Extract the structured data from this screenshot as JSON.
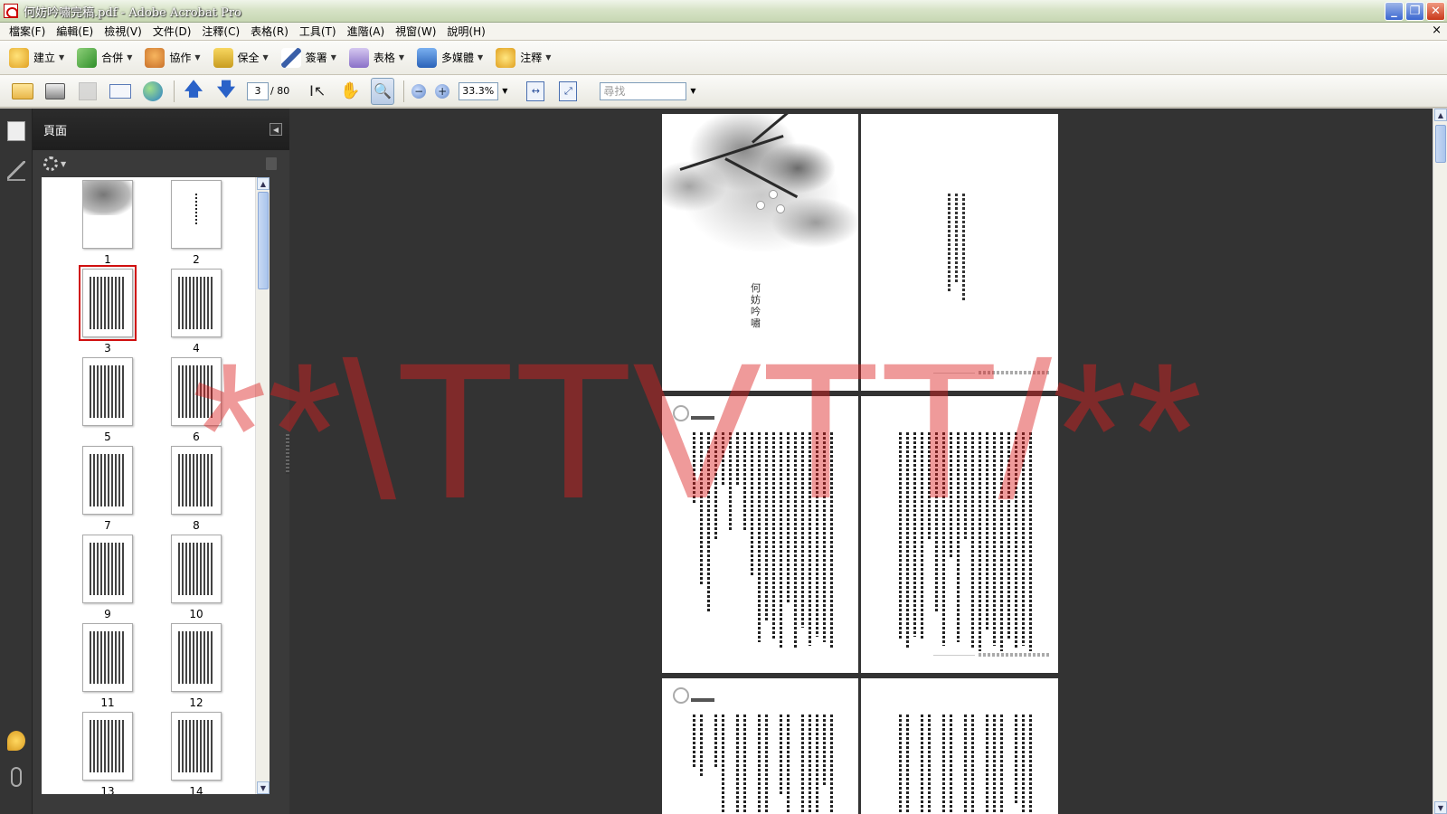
{
  "window": {
    "title": "何妨吟嘯完稿.pdf - Adobe Acrobat Pro",
    "controls": {
      "minimize": "_",
      "restore": "❐",
      "close": "✕"
    }
  },
  "menu": {
    "items": [
      "檔案(F)",
      "編輯(E)",
      "檢視(V)",
      "文件(D)",
      "注釋(C)",
      "表格(R)",
      "工具(T)",
      "進階(A)",
      "視窗(W)",
      "說明(H)"
    ],
    "close": "×"
  },
  "tasks": [
    {
      "label": "建立",
      "icon": "create-pdf-icon"
    },
    {
      "label": "合併",
      "icon": "combine-icon"
    },
    {
      "label": "協作",
      "icon": "collaborate-icon"
    },
    {
      "label": "保全",
      "icon": "lock-icon"
    },
    {
      "label": "簽署",
      "icon": "pen-icon"
    },
    {
      "label": "表格",
      "icon": "form-icon"
    },
    {
      "label": "多媒體",
      "icon": "multimedia-icon"
    },
    {
      "label": "注釋",
      "icon": "comment-icon"
    }
  ],
  "nav": {
    "current_page": "3",
    "total_pages": "/ 80",
    "zoom": "33.3%",
    "search_placeholder": "尋找"
  },
  "pages_panel": {
    "title": "頁面",
    "thumbnails": [
      {
        "label": "1"
      },
      {
        "label": "2"
      },
      {
        "label": "3",
        "selected": true
      },
      {
        "label": "4"
      },
      {
        "label": "5"
      },
      {
        "label": "6"
      },
      {
        "label": "7"
      },
      {
        "label": "8"
      },
      {
        "label": "9"
      },
      {
        "label": "10"
      },
      {
        "label": "11"
      },
      {
        "label": "12"
      },
      {
        "label": "13"
      },
      {
        "label": "14"
      }
    ]
  },
  "document": {
    "book_title": "何妨吟嘯",
    "watermark": "**\\TTVTT/**"
  },
  "colors": {
    "doc_background": "#333333",
    "selection": "#d01010",
    "watermark": "#dc1e1e"
  }
}
